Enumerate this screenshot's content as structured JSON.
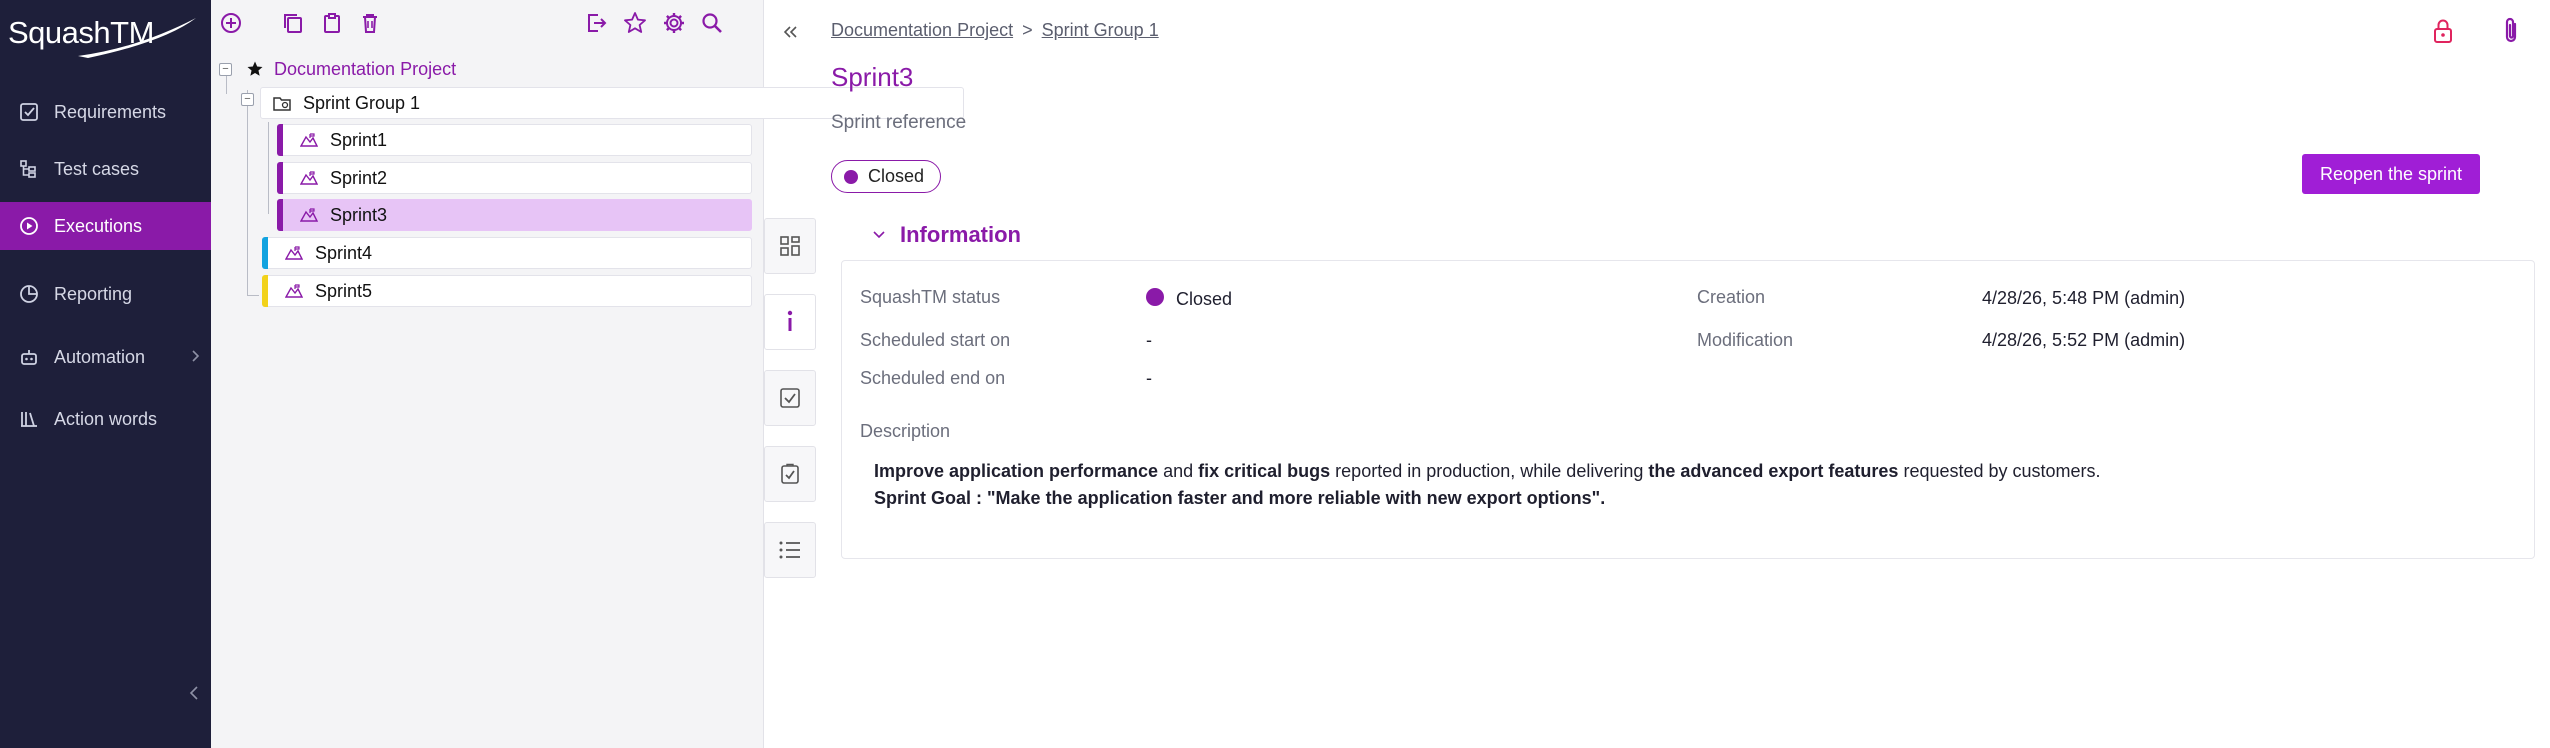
{
  "app": {
    "logo_text": "SquashTM",
    "accent": "#8a1aa8",
    "nav_bg": "#1e1f3a"
  },
  "nav": {
    "items": [
      {
        "label": "Requirements",
        "icon": "checkbox-icon"
      },
      {
        "label": "Test cases",
        "icon": "tree-structure-icon"
      },
      {
        "label": "Executions",
        "icon": "play-circle-icon",
        "active": true
      },
      {
        "label": "Reporting",
        "icon": "pie-chart-icon"
      },
      {
        "label": "Automation",
        "icon": "robot-icon"
      },
      {
        "label": "Action words",
        "icon": "library-icon"
      }
    ]
  },
  "tree": {
    "project": "Documentation Project",
    "group": "Sprint Group 1",
    "sprints": [
      {
        "label": "Sprint1",
        "color": "#8a1aa8"
      },
      {
        "label": "Sprint2",
        "color": "#8a1aa8"
      },
      {
        "label": "Sprint3",
        "color": "#8a1aa8",
        "selected": true
      },
      {
        "label": "Sprint4",
        "color": "#12a3e0"
      },
      {
        "label": "Sprint5",
        "color": "#f2d21b"
      }
    ]
  },
  "header": {
    "breadcrumb_project": "Documentation Project",
    "breadcrumb_sep": ">",
    "breadcrumb_group": "Sprint Group 1",
    "title": "Sprint3",
    "subtitle": "Sprint reference",
    "status": "Closed",
    "reopen_label": "Reopen the sprint"
  },
  "info": {
    "section_title": "Information",
    "status_label": "SquashTM status",
    "status_value": "Closed",
    "start_label": "Scheduled start on",
    "start_value": "-",
    "end_label": "Scheduled end on",
    "end_value": "-",
    "creation_label": "Creation",
    "creation_value": "4/28/26, 5:48 PM (admin)",
    "modification_label": "Modification",
    "modification_value": "4/28/26, 5:52 PM (admin)",
    "description_label": "Description",
    "description": {
      "p1_b1": "Improve application performance",
      "p1_t1": " and ",
      "p1_b2": "fix critical bugs",
      "p1_t2": " reported in production, while delivering ",
      "p1_b3": "the advanced export features",
      "p1_t3": " requested by customers.",
      "p2": "Sprint Goal : \"Make the application faster and more reliable with new export options\"."
    }
  }
}
